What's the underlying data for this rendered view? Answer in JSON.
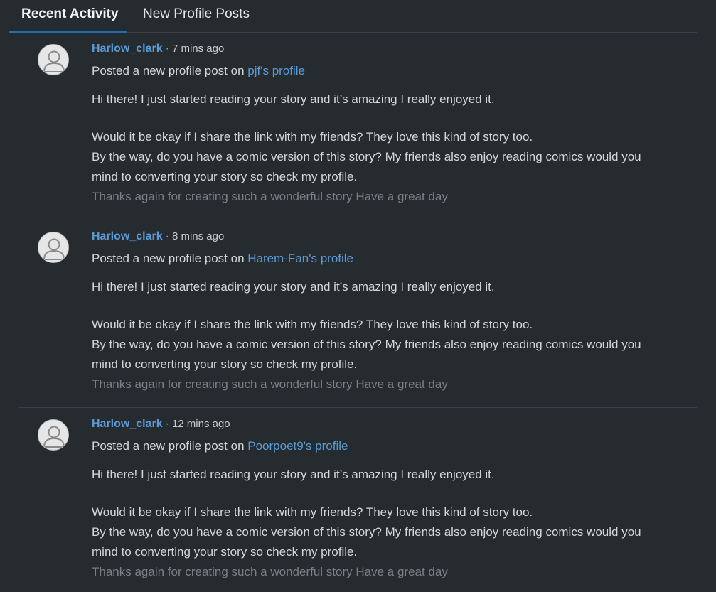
{
  "tabs": [
    {
      "label": "Recent Activity",
      "active": true
    },
    {
      "label": "New Profile Posts",
      "active": false
    }
  ],
  "colors": {
    "background": "#262b30",
    "link": "#5b9bd5",
    "tab_underline": "#1e6eb4",
    "faded_text": "#7b8085"
  },
  "entries": [
    {
      "username": "Harlow_clark",
      "separator": "·",
      "time": "7 mins ago",
      "action_prefix": "Posted a new profile post on",
      "profile_link": "pjf's profile",
      "body_line1": "Hi there! I just started reading your story and it’s amazing I really enjoyed it.",
      "body_line2": "Would it be okay if I share the link with my friends? They love this kind of story too.",
      "body_line3": "By the way, do you have a comic version of this story? My friends also enjoy reading comics would you",
      "body_line4": "mind to converting your story so check my profile.",
      "body_faded": "Thanks again for creating such a wonderful story Have a great day",
      "avatar_icon": "user-avatar-icon"
    },
    {
      "username": "Harlow_clark",
      "separator": "·",
      "time": "8 mins ago",
      "action_prefix": "Posted a new profile post on",
      "profile_link": "Harem-Fan's profile",
      "body_line1": "Hi there! I just started reading your story and it’s amazing I really enjoyed it.",
      "body_line2": "Would it be okay if I share the link with my friends? They love this kind of story too.",
      "body_line3": "By the way, do you have a comic version of this story? My friends also enjoy reading comics would you",
      "body_line4": "mind to converting your story so check my profile.",
      "body_faded": "Thanks again for creating such a wonderful story Have a great day",
      "avatar_icon": "user-avatar-icon"
    },
    {
      "username": "Harlow_clark",
      "separator": "·",
      "time": "12 mins ago",
      "action_prefix": "Posted a new profile post on",
      "profile_link": "Poorpoet9's profile",
      "body_line1": "Hi there! I just started reading your story and it’s amazing I really enjoyed it.",
      "body_line2": "Would it be okay if I share the link with my friends? They love this kind of story too.",
      "body_line3": "By the way, do you have a comic version of this story? My friends also enjoy reading comics would you",
      "body_line4": "mind to converting your story so check my profile.",
      "body_faded": "Thanks again for creating such a wonderful story Have a great day",
      "avatar_icon": "user-avatar-icon"
    }
  ]
}
